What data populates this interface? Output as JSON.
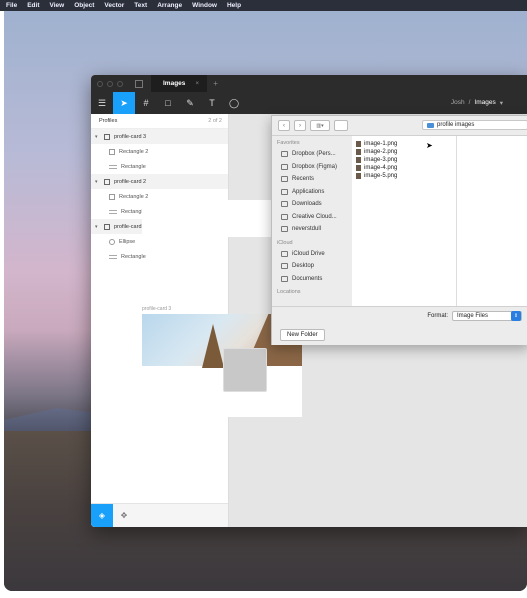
{
  "menubar": {
    "items": [
      "File",
      "Edit",
      "View",
      "Object",
      "Vector",
      "Text",
      "Arrange",
      "Window",
      "Help"
    ]
  },
  "window": {
    "tab_title": "Images",
    "tab_close": "×",
    "new_tab": "+",
    "toolbar": {
      "breadcrumb_team": "Josh",
      "breadcrumb_sep": "/",
      "breadcrumb_file": "Images",
      "chevron": "▾"
    }
  },
  "layers": {
    "header": "Profiles",
    "page_count": "2 of 2",
    "items": [
      {
        "type": "frame",
        "label": "profile-card 3"
      },
      {
        "type": "rect",
        "label": "Rectangle 2"
      },
      {
        "type": "img",
        "label": "Rectangle"
      },
      {
        "type": "frame",
        "label": "profile-card 2"
      },
      {
        "type": "rect",
        "label": "Rectangle 2"
      },
      {
        "type": "img",
        "label": "Rectangle"
      },
      {
        "type": "frame",
        "label": "profile-card 1"
      },
      {
        "type": "ellipse",
        "label": "Ellipse"
      },
      {
        "type": "img",
        "label": "Rectangle"
      }
    ]
  },
  "canvas": {
    "card_label": "profile-card 3"
  },
  "dialog": {
    "path": "profile images",
    "favorites_head": "Favorites",
    "favorites": [
      "Dropbox (Pers...",
      "Dropbox (Figma)",
      "Recents",
      "Applications",
      "Downloads",
      "Creative Cloud...",
      "neverstdull"
    ],
    "icloud_head": "iCloud",
    "icloud": [
      "iCloud Drive",
      "Desktop",
      "Documents"
    ],
    "locations_head": "Locations",
    "files": [
      "image-1.png",
      "image-2.png",
      "image-3.png",
      "image-4.png",
      "image-5.png"
    ],
    "format_label": "Format:",
    "format_value": "Image Files",
    "new_folder": "New Folder"
  }
}
